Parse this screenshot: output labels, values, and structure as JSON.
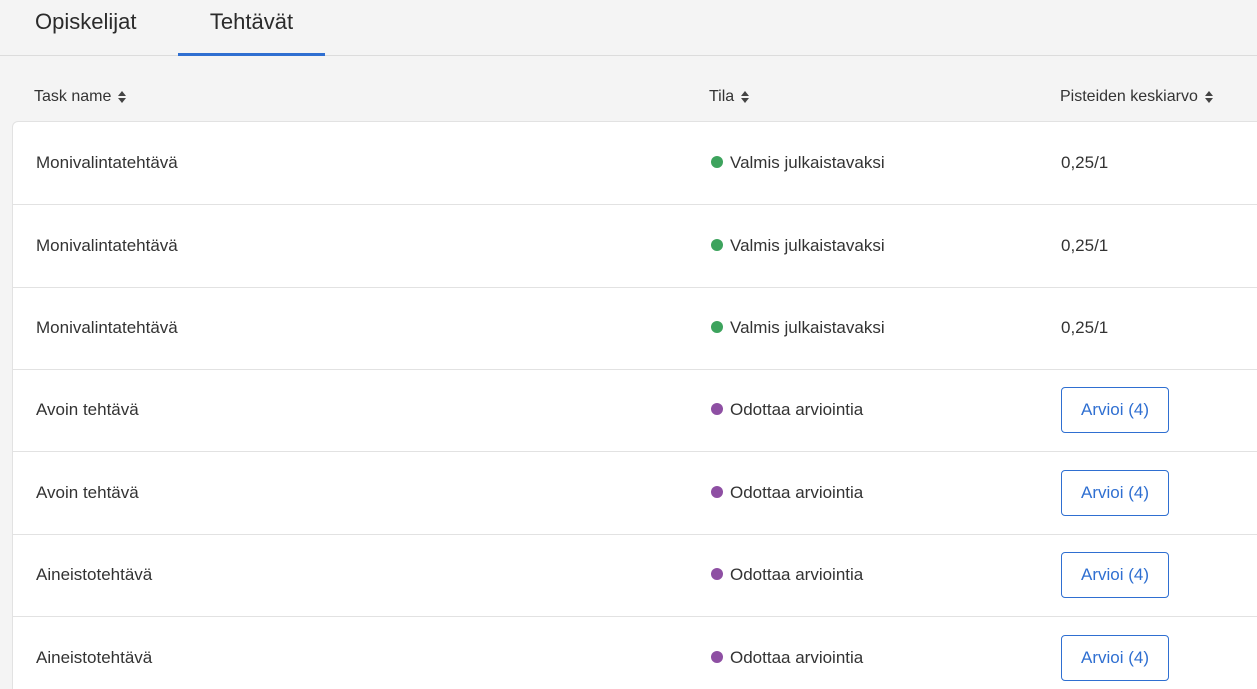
{
  "tabs": [
    {
      "label": "Opiskelijat",
      "active": false
    },
    {
      "label": "Tehtävät",
      "active": true
    }
  ],
  "table": {
    "columns": {
      "name": "Task name",
      "status": "Tila",
      "score": "Pisteiden keskiarvo"
    },
    "rows": [
      {
        "name": "Monivalintatehtävä",
        "status": "Valmis julkaistavaksi",
        "status_color": "#3da35d",
        "score": "0,25/1",
        "action": null
      },
      {
        "name": "Monivalintatehtävä",
        "status": "Valmis julkaistavaksi",
        "status_color": "#3da35d",
        "score": "0,25/1",
        "action": null
      },
      {
        "name": "Monivalintatehtävä",
        "status": "Valmis julkaistavaksi",
        "status_color": "#3da35d",
        "score": "0,25/1",
        "action": null
      },
      {
        "name": "Avoin tehtävä",
        "status": "Odottaa arviointia",
        "status_color": "#8e4fa3",
        "score": null,
        "action": "Arvioi (4)"
      },
      {
        "name": "Avoin tehtävä",
        "status": "Odottaa arviointia",
        "status_color": "#8e4fa3",
        "score": null,
        "action": "Arvioi (4)"
      },
      {
        "name": "Aineistotehtävä",
        "status": "Odottaa arviointia",
        "status_color": "#8e4fa3",
        "score": null,
        "action": "Arvioi (4)"
      },
      {
        "name": "Aineistotehtävä",
        "status": "Odottaa arviointia",
        "status_color": "#8e4fa3",
        "score": null,
        "action": "Arvioi (4)"
      }
    ]
  },
  "colors": {
    "accent": "#2f6fd1"
  }
}
